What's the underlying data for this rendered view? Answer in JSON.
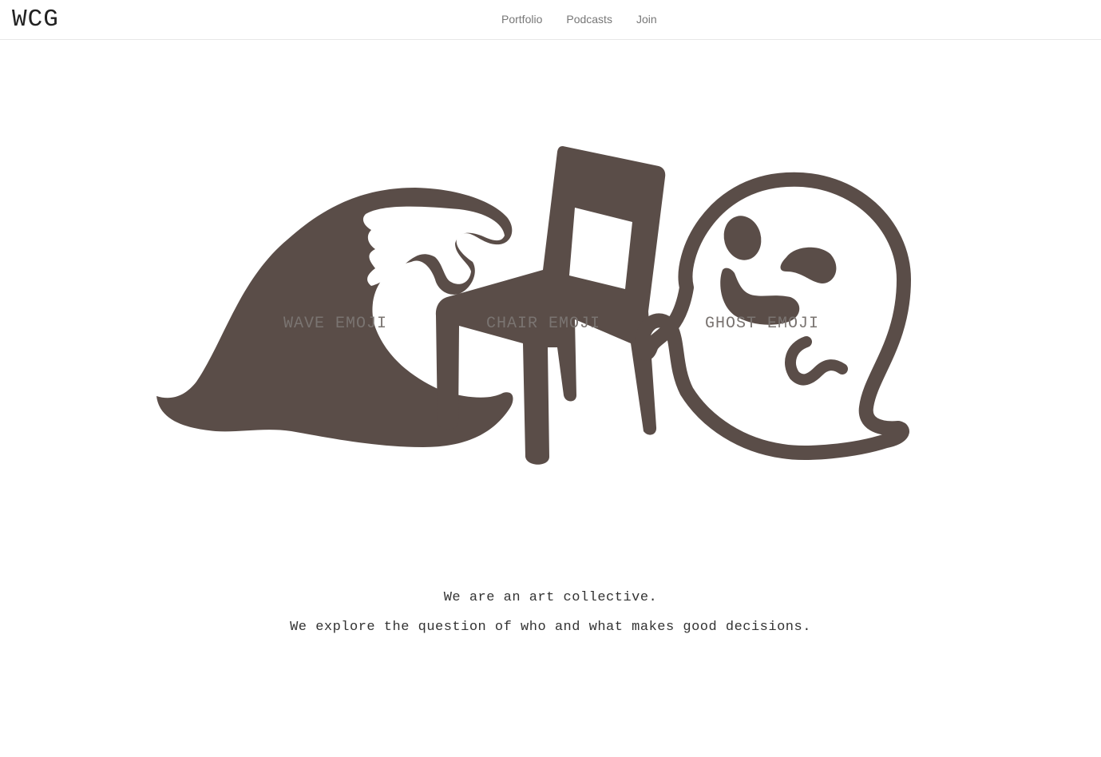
{
  "brand": {
    "name": "WCG"
  },
  "nav": {
    "items": [
      {
        "label": "Portfolio"
      },
      {
        "label": "Podcasts"
      },
      {
        "label": "Join"
      }
    ]
  },
  "hero": {
    "wave_label": "WAVE EMOJI",
    "chair_label": "CHAIR EMOJI",
    "ghost_label": "GHOST EMOJI",
    "icon_color": "#5a4d48"
  },
  "intro": {
    "line1": "We are an art collective.",
    "line2": "We explore the question of who and what makes good decisions."
  }
}
